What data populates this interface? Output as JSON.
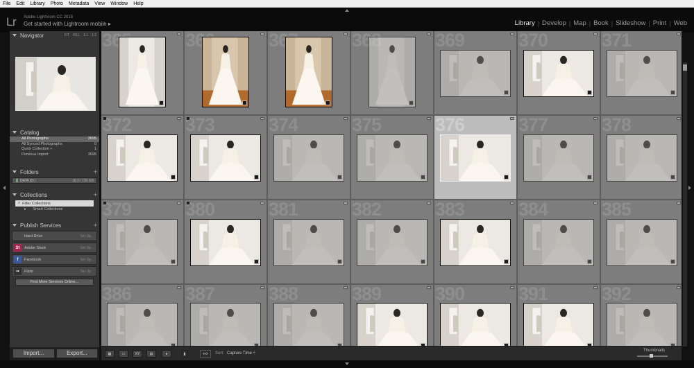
{
  "menu": [
    "File",
    "Edit",
    "Library",
    "Photo",
    "Metadata",
    "View",
    "Window",
    "Help"
  ],
  "header": {
    "logo": "Lr",
    "app_title": "Adobe Lightroom CC 2015",
    "mobile_prompt": "Get started with Lightroom mobile ▸",
    "modules": [
      "Library",
      "Develop",
      "Map",
      "Book",
      "Slideshow",
      "Print",
      "Web"
    ],
    "active_module": "Library",
    "separator": "|"
  },
  "navigator": {
    "title": "Navigator",
    "options": [
      "FIT",
      "FILL",
      "1:1",
      "1:2"
    ]
  },
  "catalog": {
    "title": "Catalog",
    "items": [
      {
        "label": "All Photographs",
        "count": "3695"
      },
      {
        "label": "All Synced Photographs",
        "count": "0"
      },
      {
        "label": "Quick Collection +",
        "count": "1"
      },
      {
        "label": "Previous Import",
        "count": "3695"
      }
    ]
  },
  "folders": {
    "title": "Folders",
    "drive_name": "DATA (D:)",
    "drive_info": "18.3 / 730 GB"
  },
  "collections": {
    "title": "Collections",
    "filter_label": "Filter Collections",
    "smart_label": "Smart Collections"
  },
  "publish": {
    "title": "Publish Services",
    "services": [
      {
        "name": "Hard Drive",
        "setup": "Set Up...",
        "icon_label": "",
        "color": "#4b4b4b"
      },
      {
        "name": "Adobe Stock",
        "setup": "Set Up...",
        "icon_label": "St",
        "color": "#a3274d"
      },
      {
        "name": "Facebook",
        "setup": "Set Up...",
        "icon_label": "f",
        "color": "#3b5998"
      },
      {
        "name": "Flickr",
        "setup": "Set Up...",
        "icon_label": "••",
        "color": "#333333"
      }
    ],
    "find_more": "Find More Services Online..."
  },
  "buttons": {
    "import": "Import...",
    "export": "Export..."
  },
  "toolbar": {
    "sort_label": "Sort:",
    "sort_value": "Capture Time ÷",
    "thumbnails_label": "Thumbnails",
    "view_icons": [
      "grid-view-icon",
      "loupe-view-icon",
      "compare-view-icon",
      "survey-view-icon",
      "people-view-icon"
    ]
  },
  "grid": {
    "cells": [
      {
        "num": "365",
        "orient": "portrait",
        "bright": true
      },
      {
        "num": "366",
        "orient": "portrait",
        "bright": true,
        "warm": true
      },
      {
        "num": "367",
        "orient": "portrait",
        "bright": true,
        "warm": true
      },
      {
        "num": "368",
        "orient": "portrait",
        "bright": false
      },
      {
        "num": "369",
        "orient": "landscape",
        "bright": false
      },
      {
        "num": "370",
        "orient": "landscape",
        "bright": true
      },
      {
        "num": "371",
        "orient": "landscape",
        "bright": false
      },
      {
        "num": "372",
        "orient": "landscape",
        "bright": true
      },
      {
        "num": "373",
        "orient": "landscape",
        "bright": true
      },
      {
        "num": "374",
        "orient": "landscape",
        "bright": false
      },
      {
        "num": "375",
        "orient": "landscape",
        "bright": false
      },
      {
        "num": "376",
        "orient": "landscape",
        "bright": true,
        "selected": true
      },
      {
        "num": "377",
        "orient": "landscape",
        "bright": false
      },
      {
        "num": "378",
        "orient": "landscape",
        "bright": false
      },
      {
        "num": "379",
        "orient": "landscape",
        "bright": false
      },
      {
        "num": "380",
        "orient": "landscape",
        "bright": true
      },
      {
        "num": "381",
        "orient": "landscape",
        "bright": false
      },
      {
        "num": "382",
        "orient": "landscape",
        "bright": false
      },
      {
        "num": "383",
        "orient": "landscape",
        "bright": true
      },
      {
        "num": "384",
        "orient": "landscape",
        "bright": false
      },
      {
        "num": "385",
        "orient": "landscape",
        "bright": false
      },
      {
        "num": "386",
        "orient": "landscape",
        "bright": false
      },
      {
        "num": "387",
        "orient": "landscape",
        "bright": false
      },
      {
        "num": "388",
        "orient": "landscape",
        "bright": false
      },
      {
        "num": "389",
        "orient": "landscape",
        "bright": true
      },
      {
        "num": "390",
        "orient": "landscape",
        "bright": true
      },
      {
        "num": "391",
        "orient": "landscape",
        "bright": true
      },
      {
        "num": "392",
        "orient": "landscape",
        "bright": false
      }
    ]
  }
}
